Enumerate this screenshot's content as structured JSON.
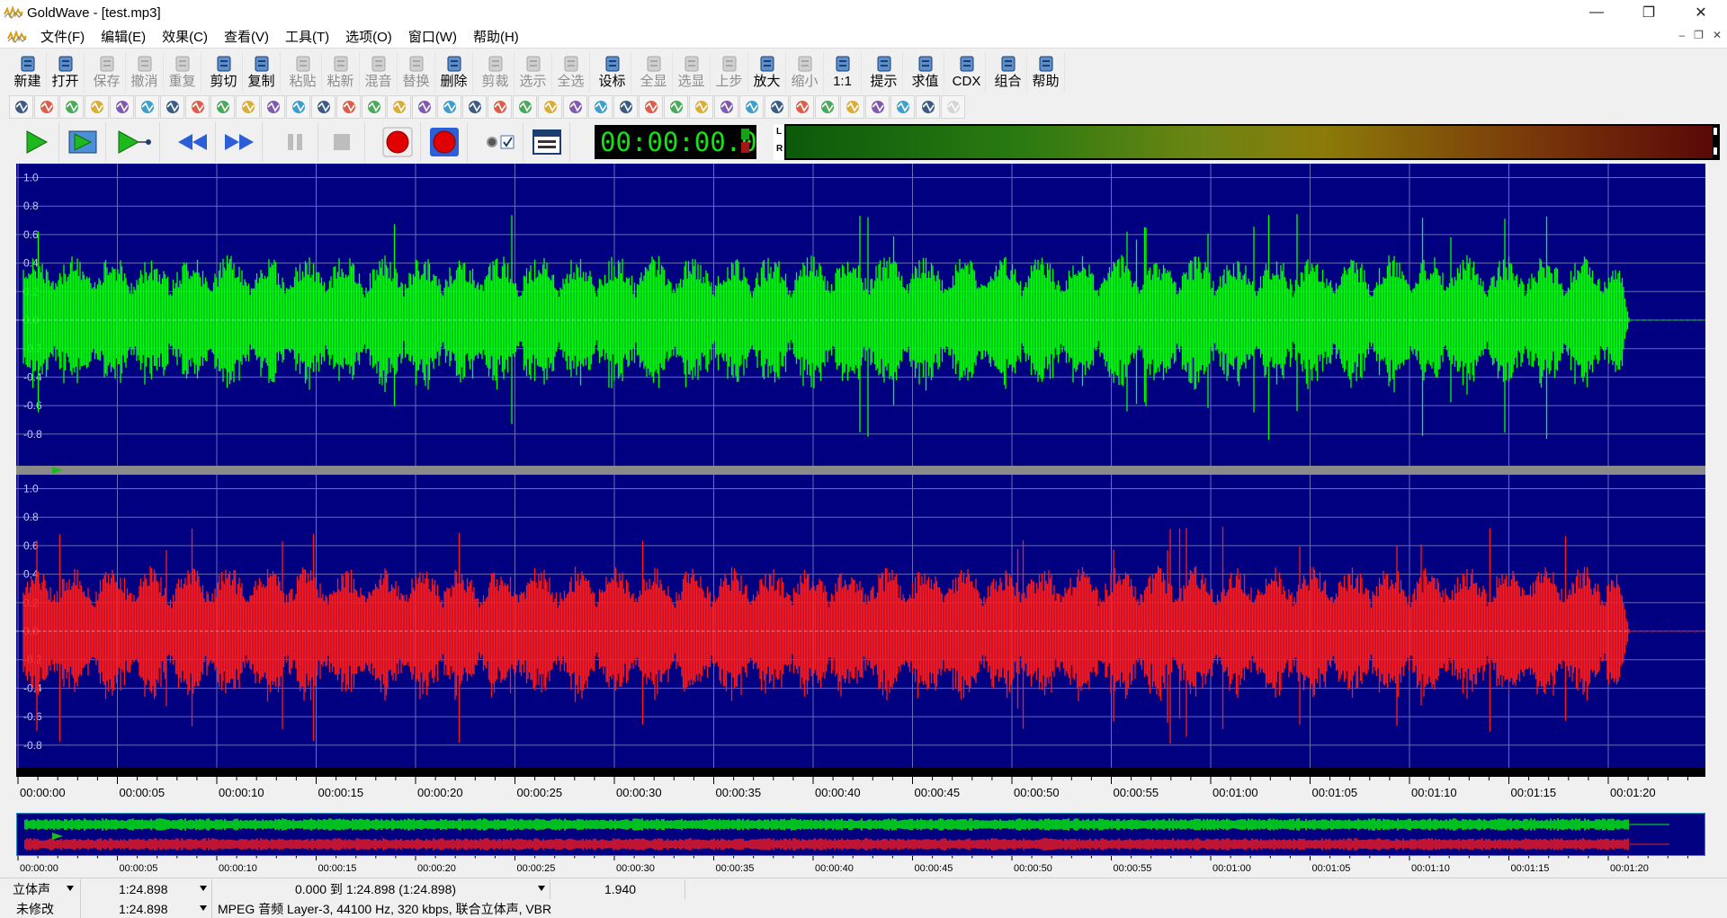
{
  "window": {
    "title": "GoldWave - [test.mp3]",
    "controls": [
      "minimize",
      "restore",
      "close"
    ]
  },
  "menu": {
    "items": [
      "文件(F)",
      "编辑(E)",
      "效果(C)",
      "查看(V)",
      "工具(T)",
      "选项(O)",
      "窗口(W)",
      "帮助(H)"
    ]
  },
  "toolbar": {
    "buttons": [
      {
        "label": "新建",
        "icon": "new-file-icon",
        "enabled": true
      },
      {
        "label": "打开",
        "icon": "open-folder-icon",
        "enabled": true
      },
      {
        "label": "保存",
        "icon": "save-icon",
        "enabled": false
      },
      {
        "label": "撤消",
        "icon": "undo-icon",
        "enabled": false
      },
      {
        "label": "重复",
        "icon": "redo-icon",
        "enabled": false
      },
      {
        "label": "剪切",
        "icon": "scissors-icon",
        "enabled": true
      },
      {
        "label": "复制",
        "icon": "copy-icon",
        "enabled": true
      },
      {
        "label": "粘贴",
        "icon": "paste-icon",
        "enabled": false
      },
      {
        "label": "粘新",
        "icon": "paste-new-icon",
        "enabled": false
      },
      {
        "label": "混音",
        "icon": "mix-icon",
        "enabled": false
      },
      {
        "label": "替换",
        "icon": "replace-icon",
        "enabled": false
      },
      {
        "label": "删除",
        "icon": "delete-icon",
        "enabled": true
      },
      {
        "label": "剪裁",
        "icon": "trim-icon",
        "enabled": false
      },
      {
        "label": "选示",
        "icon": "select-view-icon",
        "enabled": false
      },
      {
        "label": "全选",
        "icon": "select-all-icon",
        "enabled": false
      },
      {
        "label": "设标",
        "icon": "set-marker-icon",
        "enabled": true
      },
      {
        "label": "全显",
        "icon": "zoom-all-icon",
        "enabled": false
      },
      {
        "label": "选显",
        "icon": "zoom-selection-icon",
        "enabled": false
      },
      {
        "label": "上步",
        "icon": "zoom-previous-icon",
        "enabled": false
      },
      {
        "label": "放大",
        "icon": "zoom-in-icon",
        "enabled": true
      },
      {
        "label": "缩小",
        "icon": "zoom-out-icon",
        "enabled": false
      },
      {
        "label": "1:1",
        "icon": "zoom-1to1-icon",
        "enabled": true
      },
      {
        "label": "提示",
        "icon": "cue-icon",
        "enabled": true
      },
      {
        "label": "求值",
        "icon": "evaluate-icon",
        "enabled": true
      },
      {
        "label": "CDX",
        "icon": "cd-icon",
        "enabled": true
      },
      {
        "label": "组合",
        "icon": "combine-icon",
        "enabled": true
      },
      {
        "label": "帮助",
        "icon": "help-icon",
        "enabled": true
      }
    ]
  },
  "effects_toolbar": {
    "count": 38
  },
  "transport": {
    "buttons": [
      "play-icon",
      "play-selection-icon",
      "play-from-icon",
      "rewind-icon",
      "fast-forward-icon",
      "pause-icon",
      "stop-icon",
      "record-icon",
      "record-new-icon",
      "checkbox-icon",
      "view-icon"
    ],
    "timecode": "00:00:00.0",
    "meter_labels": [
      "L",
      "R"
    ]
  },
  "waveform": {
    "amplitude_labels": [
      "1.0",
      "0.8",
      "0.6",
      "0.4",
      "0.2",
      "0.0",
      "-0.2",
      "-0.4",
      "-0.6",
      "-0.8"
    ],
    "left_color": "#00ff00",
    "right_color": "#ff1a1a",
    "background": "#000080",
    "audio_end_fraction": 0.955
  },
  "timeline": {
    "labels": [
      "00:00:00",
      "00:00:05",
      "00:00:10",
      "00:00:15",
      "00:00:20",
      "00:00:25",
      "00:00:30",
      "00:00:35",
      "00:00:40",
      "00:00:45",
      "00:00:50",
      "00:00:55",
      "00:01:00",
      "00:01:05",
      "00:01:10",
      "00:01:15",
      "00:01:20"
    ]
  },
  "status": {
    "channel_mode": "立体声",
    "length_1": "1:24.898",
    "selection": "0.000 到 1:24.898 (1:24.898)",
    "zoom": "1.940",
    "modified_state": "未修改",
    "length_2": "1:24.898",
    "format_info": "MPEG 音频 Layer-3, 44100 Hz, 320 kbps, 联合立体声, VBR"
  }
}
